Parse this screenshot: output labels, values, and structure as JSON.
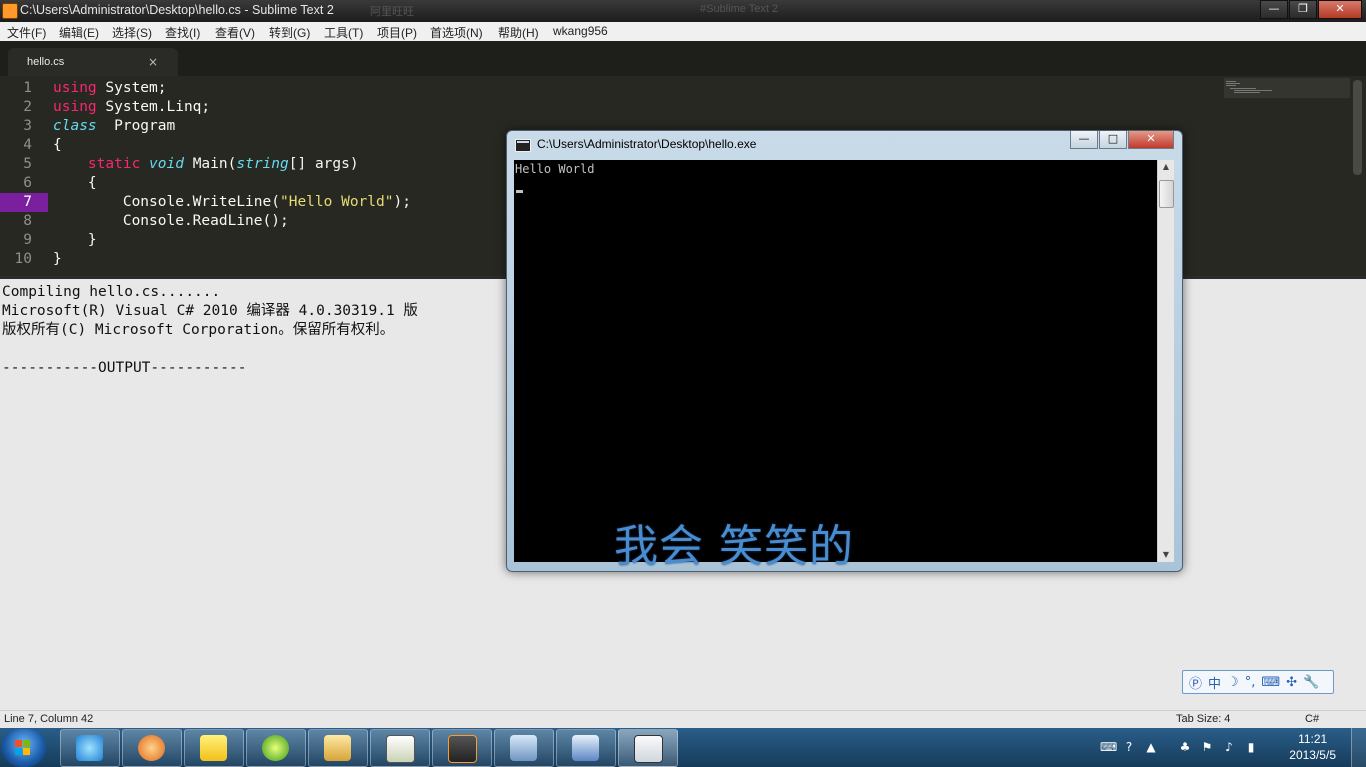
{
  "window": {
    "title": "C:\\Users\\Administrator\\Desktop\\hello.cs - Sublime Text 2",
    "ghost_tabs": [
      "阿里旺旺",
      "#Sublime Text 2"
    ],
    "buttons": {
      "minimize": "—",
      "maximize": "❐",
      "close": "✕"
    }
  },
  "menu": [
    "文件(F)",
    "编辑(E)",
    "选择(S)",
    "查找(I)",
    "查看(V)",
    "转到(G)",
    "工具(T)",
    "项目(P)",
    "首选项(N)",
    "帮助(H)",
    "wkang956"
  ],
  "tab": {
    "name": "hello.cs",
    "close": "×"
  },
  "editor": {
    "active_line": 7,
    "line_numbers": [
      "1",
      "2",
      "3",
      "4",
      "5",
      "6",
      "7",
      "8",
      "9",
      "10"
    ],
    "code": {
      "l1": {
        "kw": "using",
        "rest": " System;"
      },
      "l2": {
        "kw": "using",
        "rest": " System.Linq;"
      },
      "l3": {
        "kw": "class",
        "rest": "  Program"
      },
      "l4": "{",
      "l5": {
        "indent": "    ",
        "kw": "static",
        "sp": " ",
        "ty": "void",
        "mid": " Main(",
        "ty2": "string",
        "rest": "[] args)"
      },
      "l6": "    {",
      "l7": {
        "pre": "        Console.WriteLine(",
        "str": "\"Hello World\"",
        "post": ");"
      },
      "l8": "        Console.ReadLine();",
      "l9": "    }",
      "l10": "}"
    }
  },
  "output": [
    "Compiling hello.cs.......",
    "Microsoft(R) Visual C# 2010 编译器 4.0.30319.1 版",
    "版权所有(C) Microsoft Corporation。保留所有权利。",
    "",
    "-----------OUTPUT-----------"
  ],
  "console": {
    "title": "C:\\Users\\Administrator\\Desktop\\hello.exe",
    "output": "Hello World",
    "buttons": {
      "minimize": "—",
      "maximize": "□",
      "close": "✕"
    },
    "scroll_up": "▲",
    "scroll_down": "▼"
  },
  "overlay_text": "我会 笑笑的",
  "ime_toolbar": [
    "Ⓟ",
    "中",
    "☽",
    "°,",
    "⌨",
    "✣",
    "🔧"
  ],
  "status": {
    "position": "Line 7, Column 42",
    "tab_size": "Tab Size: 4",
    "syntax": "C#"
  },
  "tray": {
    "time": "11:21",
    "date": "2013/5/5"
  },
  "colors": {
    "keyword": "#f92672",
    "type": "#66d9ef",
    "string": "#e6db74",
    "active_line": "#7a1f9e"
  }
}
